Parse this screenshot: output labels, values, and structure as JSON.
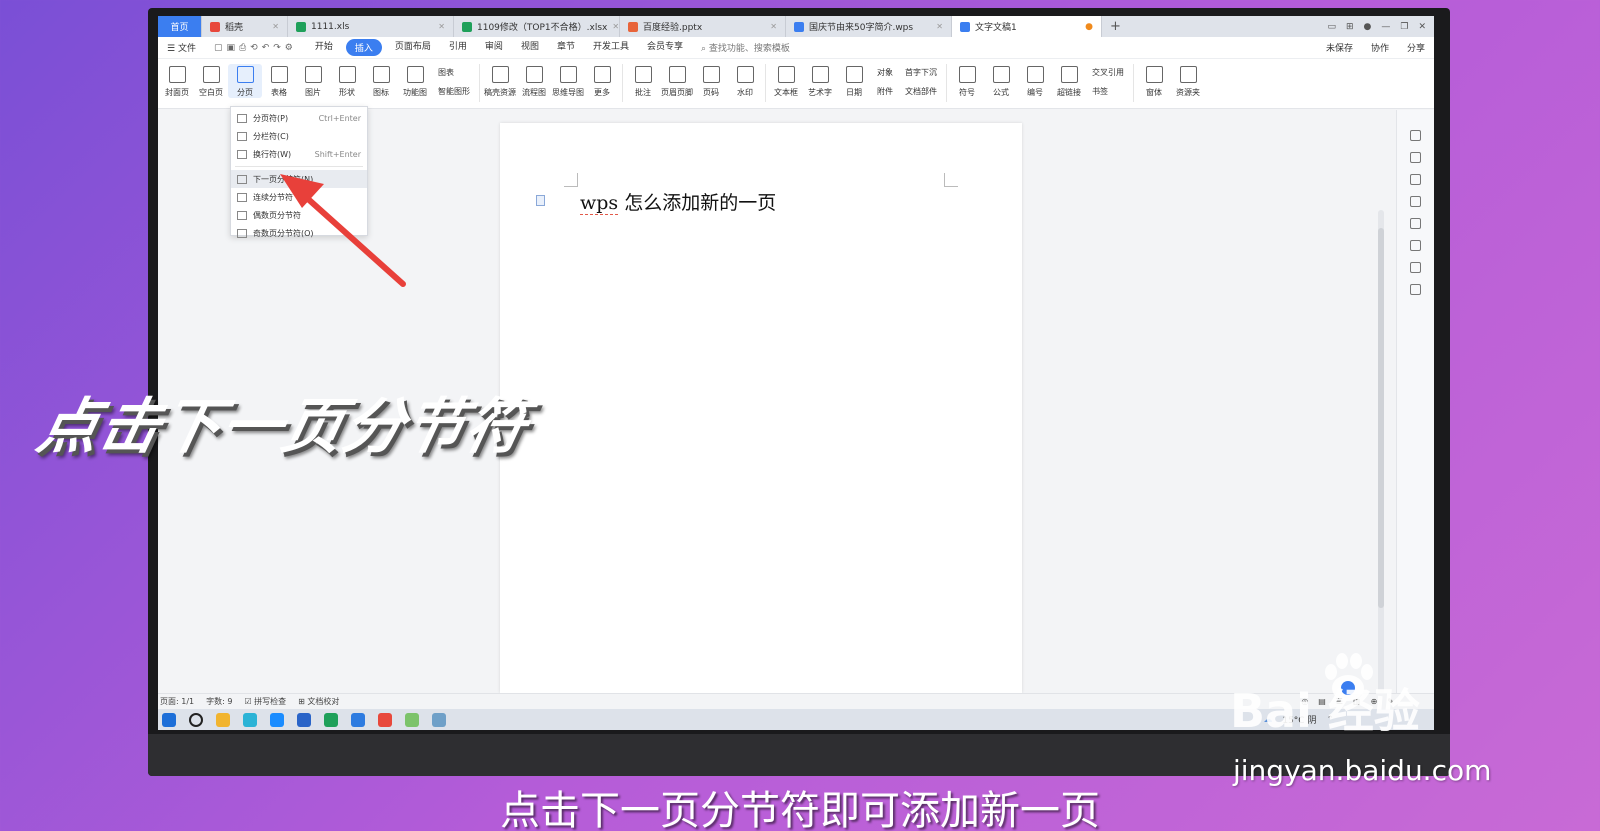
{
  "tabs": [
    {
      "label": "首页",
      "type": "home"
    },
    {
      "label": "稻壳",
      "color": "#e8483c"
    },
    {
      "label": "1111.xls",
      "color": "#1fa05a"
    },
    {
      "label": "1109修改（TOP1不合格）.xlsx",
      "color": "#1fa05a"
    },
    {
      "label": "百度经验.pptx",
      "color": "#e8643a"
    },
    {
      "label": "国庆节由来50字简介.wps",
      "color": "#3b7ef0"
    },
    {
      "label": "文字文稿1",
      "color": "#3b7ef0",
      "active": true
    }
  ],
  "menubar": {
    "file": "文件",
    "items": [
      "开始",
      "插入",
      "页面布局",
      "引用",
      "审阅",
      "视图",
      "章节",
      "开发工具",
      "会员专享"
    ],
    "active": "插入",
    "search": "查找功能、搜索模板",
    "right": [
      "未保存",
      "协作",
      "分享"
    ]
  },
  "ribbon": {
    "buttons": [
      "封面页",
      "空白页",
      "分页",
      "表格",
      "图片",
      "形状",
      "图标",
      "功能图"
    ],
    "stack1": [
      "图表",
      "智能图形"
    ],
    "buttons2": [
      "稿壳资源",
      "流程图",
      "思维导图",
      "更多",
      "批注",
      "页眉页脚",
      "页码",
      "水印",
      "文本框",
      "艺术字",
      "日期"
    ],
    "stack2": [
      "对象",
      "附件"
    ],
    "stack3": [
      "首字下沉",
      "文档部件"
    ],
    "buttons3": [
      "符号",
      "公式",
      "编号",
      "超链接"
    ],
    "stack4": [
      "交叉引用",
      "书签"
    ],
    "buttons4": [
      "窗体",
      "资源夹"
    ]
  },
  "dropdown": [
    {
      "label": "分页符(P)",
      "shortcut": "Ctrl+Enter"
    },
    {
      "label": "分栏符(C)",
      "shortcut": ""
    },
    {
      "label": "换行符(W)",
      "shortcut": "Shift+Enter"
    },
    {
      "label": "下一页分节符(N)",
      "shortcut": "",
      "highlight": true
    },
    {
      "label": "连续分节符",
      "shortcut": ""
    },
    {
      "label": "偶数页分节符",
      "shortcut": ""
    },
    {
      "label": "奇数页分节符(O)",
      "shortcut": ""
    }
  ],
  "document": {
    "text_latin": "wps",
    "text_rest": " 怎么添加新的一页"
  },
  "statusbar": {
    "page": "页面: 1/1",
    "words": "字数: 9",
    "spell": "拼写检查",
    "proof": "文档校对"
  },
  "taskbar": {
    "weather": "15°C 阴",
    "icon_colors": [
      "#1c6ed8",
      "#222",
      "#f1b42f",
      "#2bb3d6",
      "#1a8cff",
      "#2a64c8",
      "#1fa05a",
      "#2d7be0",
      "#e8483c",
      "#7cc36b",
      "#6fa0c8"
    ]
  },
  "captions": {
    "left": "点击下一页分节符",
    "bottom": "点击下一页分节符即可添加新一页"
  },
  "watermark": {
    "logo": "Bai  经验",
    "url": "jingyan.baidu.com"
  },
  "colors": {
    "accent": "#3b7ef0",
    "arrow": "#e8403a"
  }
}
